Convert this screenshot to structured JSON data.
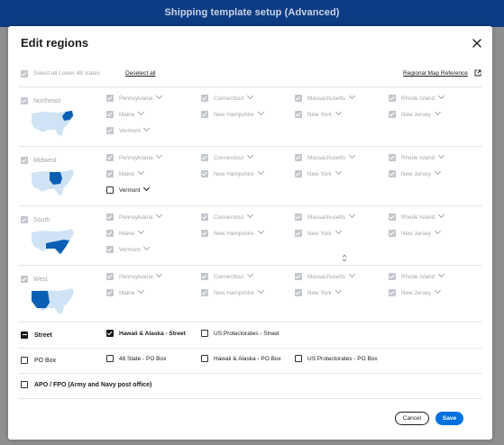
{
  "page_title": "Shipping template setup (Advanced)",
  "modal": {
    "title": "Edit regions",
    "select_all_label": "Select all Lower 48 states",
    "deselect_all": "Deselect all",
    "regional_map_ref": "Regional Map Reference"
  },
  "regions": [
    {
      "name": "Northeast",
      "states": [
        {
          "label": "Pennsylvania",
          "dark": false,
          "checked": true
        },
        {
          "label": "Connecticut",
          "dark": false,
          "checked": true
        },
        {
          "label": "Massachusetts",
          "dark": false,
          "checked": true
        },
        {
          "label": "Rhode Island",
          "dark": false,
          "checked": true
        },
        {
          "label": "Maine",
          "dark": false,
          "checked": true
        },
        {
          "label": "New Hampshire",
          "dark": false,
          "checked": true
        },
        {
          "label": "New York",
          "dark": false,
          "checked": true
        },
        {
          "label": "New Jersey",
          "dark": false,
          "checked": true
        },
        {
          "label": "Vermont",
          "dark": false,
          "checked": true
        }
      ]
    },
    {
      "name": "Midwest",
      "states": [
        {
          "label": "Pennsylvania",
          "dark": false,
          "checked": true
        },
        {
          "label": "Connecticut",
          "dark": false,
          "checked": true
        },
        {
          "label": "Massachusetts",
          "dark": false,
          "checked": true
        },
        {
          "label": "Rhode Island",
          "dark": false,
          "checked": true
        },
        {
          "label": "Maine",
          "dark": false,
          "checked": true
        },
        {
          "label": "New Hampshire",
          "dark": false,
          "checked": true
        },
        {
          "label": "New York",
          "dark": false,
          "checked": true
        },
        {
          "label": "New Jersey",
          "dark": false,
          "checked": true
        },
        {
          "label": "Vermont",
          "dark": true,
          "checked": false
        }
      ]
    },
    {
      "name": "South",
      "states": [
        {
          "label": "Pennsylvania",
          "dark": false,
          "checked": true
        },
        {
          "label": "Connecticut",
          "dark": false,
          "checked": true
        },
        {
          "label": "Massachusetts",
          "dark": false,
          "checked": true
        },
        {
          "label": "Rhode Island",
          "dark": false,
          "checked": true
        },
        {
          "label": "Maine",
          "dark": false,
          "checked": true
        },
        {
          "label": "New Hampshire",
          "dark": false,
          "checked": true
        },
        {
          "label": "New York",
          "dark": false,
          "checked": true
        },
        {
          "label": "New Jersey",
          "dark": false,
          "checked": true
        },
        {
          "label": "Vermont",
          "dark": false,
          "checked": true
        }
      ]
    },
    {
      "name": "West",
      "states": [
        {
          "label": "Pennsylvania",
          "dark": false,
          "checked": true
        },
        {
          "label": "Connecticut",
          "dark": false,
          "checked": true
        },
        {
          "label": "Massachusetts",
          "dark": false,
          "checked": true
        },
        {
          "label": "Rhode Island",
          "dark": false,
          "checked": true
        },
        {
          "label": "Maine",
          "dark": false,
          "checked": true
        },
        {
          "label": "New Hampshire",
          "dark": false,
          "checked": true
        },
        {
          "label": "New York",
          "dark": false,
          "checked": true
        },
        {
          "label": "New Jersey",
          "dark": false,
          "checked": true
        }
      ]
    }
  ],
  "street": {
    "label": "Street",
    "options": [
      "Hawaii & Alaska - Street",
      "US Protectorates - Street"
    ]
  },
  "pobox": {
    "label": "PO Box",
    "options": [
      "48 State - PO Box",
      "Hawaii & Alaska - PO Box",
      "US Protectorates - PO Box"
    ]
  },
  "apo": {
    "label": "APO / FPO (Army and Navy post office)"
  },
  "buttons": {
    "cancel": "Cancel",
    "save": "Save"
  },
  "colors": {
    "header": "#0e3c84",
    "accent": "#0071dc",
    "map_base": "#cfe3f5",
    "map_highlight": "#0a5fb4"
  },
  "icons": [
    "close-icon",
    "external-link-icon",
    "chevron-down-icon",
    "checkbox-icon",
    "us-map-icon",
    "sort-icon"
  ]
}
